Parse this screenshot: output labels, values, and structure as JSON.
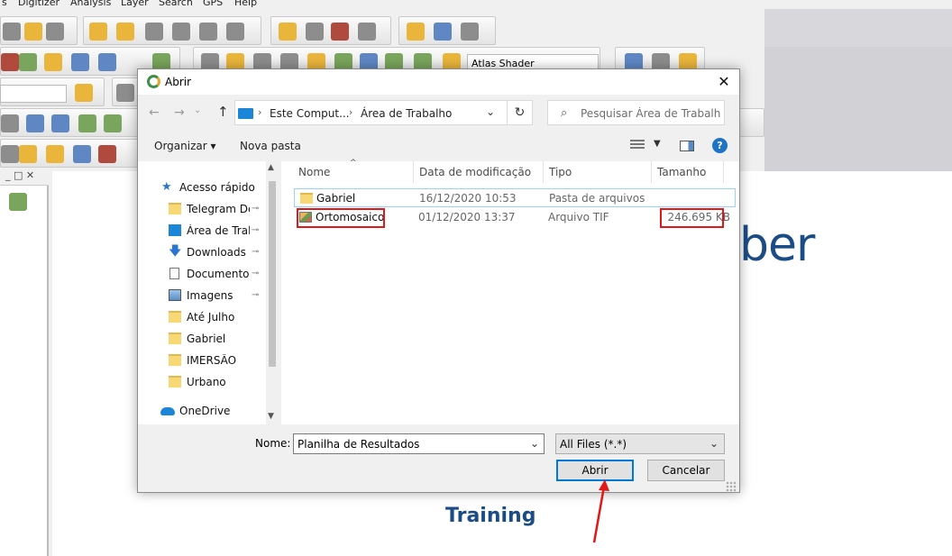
{
  "background_app": {
    "menu": [
      "s",
      "Digitizer",
      "Analysis",
      "Layer",
      "Search",
      "GPS",
      "Help"
    ],
    "shader_combo": "Atlas Shader",
    "brand_fragment": "ber",
    "brand_training": "Training",
    "panel_controls": "_ □ ✕"
  },
  "dialog": {
    "title": "Abrir",
    "close_glyph": "✕",
    "address": {
      "crumbs": [
        "Este Comput...",
        "Área de Trabalho"
      ],
      "separator": "›",
      "dropdown_glyph": "⌄"
    },
    "refresh_glyph": "↻",
    "search": {
      "placeholder": "Pesquisar Área de Trabalho",
      "icon": "search-icon"
    },
    "commands": {
      "organize": "Organizar ▾",
      "new_folder": "Nova pasta",
      "view_dd": "▼",
      "help": "?"
    },
    "nav": {
      "items": [
        {
          "label": "Acesso rápido",
          "icon": "star-icon",
          "pinned": false
        },
        {
          "label": "Telegram Des",
          "icon": "folder-icon",
          "pinned": true
        },
        {
          "label": "Área de Traba",
          "icon": "desktop-icon",
          "pinned": true
        },
        {
          "label": "Downloads",
          "icon": "download-icon",
          "pinned": true
        },
        {
          "label": "Documentos",
          "icon": "document-icon",
          "pinned": true
        },
        {
          "label": "Imagens",
          "icon": "pictures-icon",
          "pinned": true
        },
        {
          "label": "Até Julho",
          "icon": "folder-icon",
          "pinned": false
        },
        {
          "label": "Gabriel",
          "icon": "folder-icon",
          "pinned": false
        },
        {
          "label": "IMERSÃO",
          "icon": "folder-icon",
          "pinned": false
        },
        {
          "label": "Urbano",
          "icon": "folder-icon",
          "pinned": false
        },
        {
          "label": "OneDrive",
          "icon": "cloud-icon",
          "pinned": false
        }
      ],
      "pin_glyph": "📌"
    },
    "columns": {
      "name": "Nome",
      "modified": "Data de modificação",
      "type": "Tipo",
      "size": "Tamanho",
      "sort_glyph": "^"
    },
    "files": [
      {
        "name": "Gabriel",
        "modified": "16/12/2020 10:53",
        "type": "Pasta de arquivos",
        "size": "",
        "icon": "folder-icon"
      },
      {
        "name": "Ortomosaico",
        "modified": "01/12/2020 13:37",
        "type": "Arquivo TIF",
        "size": "246.695 KB",
        "icon": "tif-image-icon"
      }
    ],
    "filename": {
      "label": "Nome:",
      "value": "Planilha de Resultados"
    },
    "filter": {
      "value": "All Files (*.*)"
    },
    "buttons": {
      "open": "Abrir",
      "cancel": "Cancelar"
    },
    "nav_glyphs": {
      "back": "←",
      "forward": "→",
      "history": "⌄",
      "up": "↑",
      "scroll_up": "▲",
      "scroll_down": "▼"
    }
  },
  "colors": {
    "accent": "#0078d7",
    "highlight": "#e01818",
    "brand": "#1c4c86"
  }
}
